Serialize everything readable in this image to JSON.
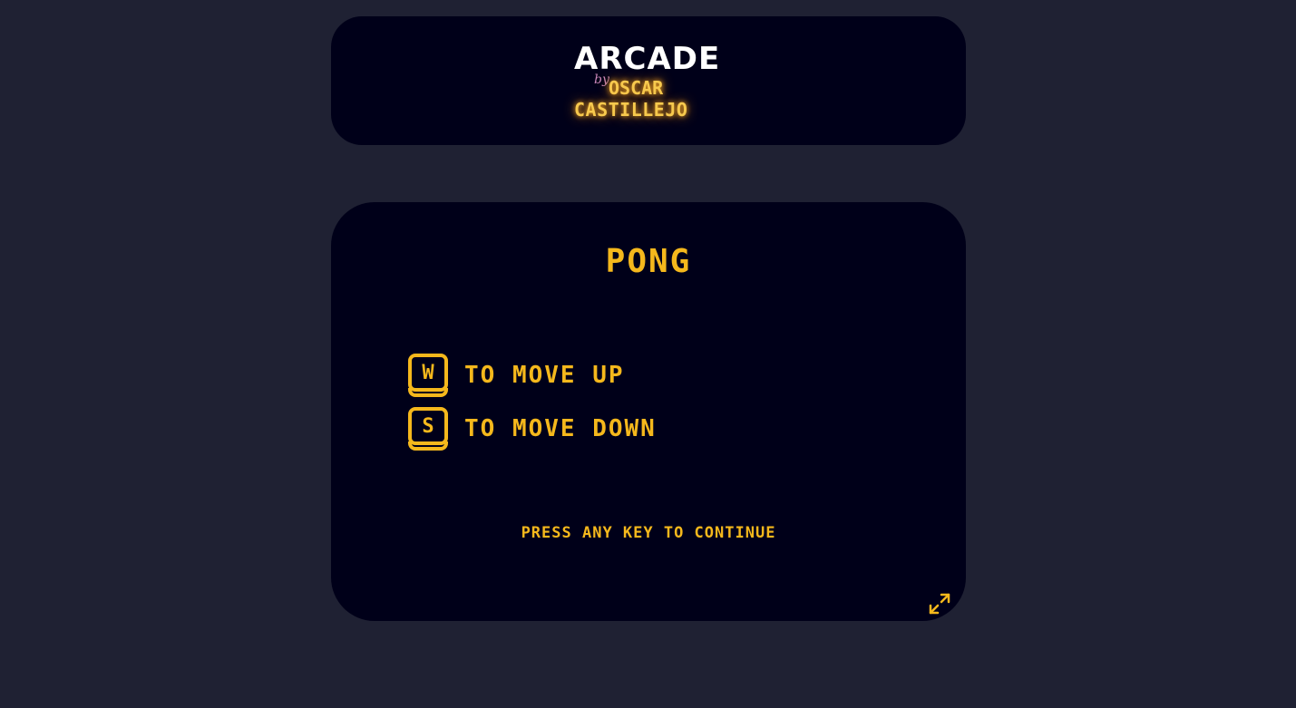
{
  "header": {
    "logo_title": "ARCADE",
    "logo_by": "by",
    "logo_name_line1": "OSCAR",
    "logo_name_line2": "CASTILLEJO"
  },
  "game": {
    "title": "PONG",
    "controls": [
      {
        "key": "W",
        "action": "TO MOVE UP"
      },
      {
        "key": "S",
        "action": "TO MOVE DOWN"
      }
    ],
    "continue_prompt": "PRESS ANY KEY TO CONTINUE",
    "fullscreen_icon": "expand-icon"
  },
  "colors": {
    "background": "#1f2133",
    "card": "#000019",
    "accent": "#f5b81c",
    "logo_white": "#ffffff",
    "logo_glow": "#f7c94d",
    "logo_by": "#c987b8"
  }
}
